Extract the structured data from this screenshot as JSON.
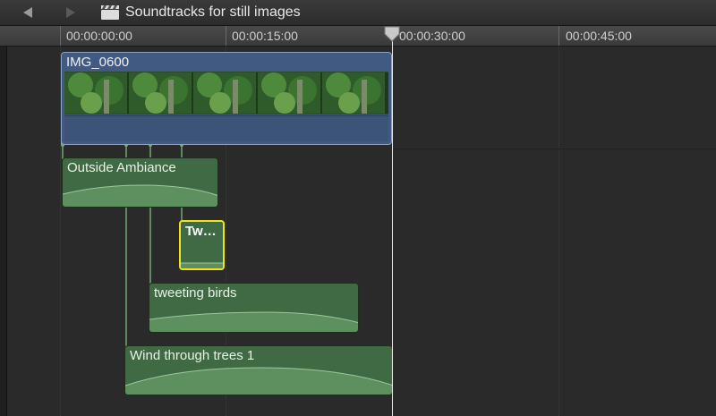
{
  "toolbar": {
    "back_icon": "back-arrow-icon",
    "forward_icon": "forward-arrow-icon",
    "project_icon": "clapperboard-icon",
    "project_title": "Soundtracks for still images"
  },
  "ruler": {
    "ticks": [
      "00:00:00:00",
      "00:00:15:00",
      "00:00:30:00",
      "00:00:45:00"
    ]
  },
  "video_clip": {
    "name": "IMG_0600"
  },
  "audio_clips": [
    {
      "name": "Outside Ambiance"
    },
    {
      "name": "Tw…"
    },
    {
      "name": "tweeting birds"
    },
    {
      "name": "Wind through trees 1"
    }
  ],
  "colors": {
    "video_clip": "#405a82",
    "audio_clip": "#3f6a43",
    "selection": "#f4e21a",
    "playhead": "#e6e6e6"
  }
}
